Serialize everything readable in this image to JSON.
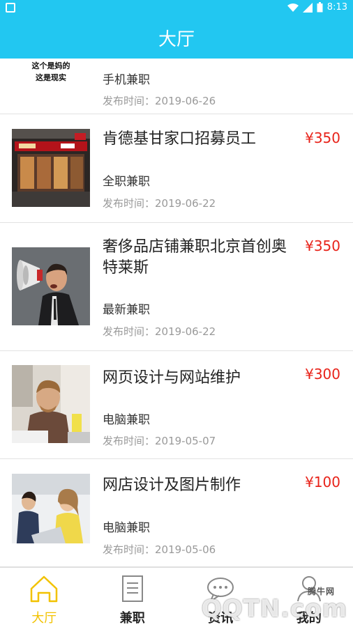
{
  "status_bar": {
    "time": "8:13"
  },
  "header": {
    "title": "大厅"
  },
  "jobs": [
    {
      "title": "",
      "thumb_text": [
        "这个是妈的",
        "这是现实"
      ],
      "category": "手机兼职",
      "date": "发布时间：2019-06-26",
      "price": ""
    },
    {
      "title": "肯德基甘家口招募员工",
      "category": "全职兼职",
      "date": "发布时间：2019-06-22",
      "price": "¥350"
    },
    {
      "title": "奢侈品店铺兼职北京首创奥特莱斯",
      "category": "最新兼职",
      "date": "发布时间：2019-06-22",
      "price": "¥350"
    },
    {
      "title": "网页设计与网站维护",
      "category": "电脑兼职",
      "date": "发布时间：2019-05-07",
      "price": "¥300"
    },
    {
      "title": "网店设计及图片制作",
      "category": "电脑兼职",
      "date": "发布时间：2019-05-06",
      "price": "¥100"
    }
  ],
  "tabs": [
    {
      "label": "大厅",
      "active": true
    },
    {
      "label": "兼职",
      "active": false
    },
    {
      "label": "资讯",
      "active": false
    },
    {
      "label": "我的",
      "active": false
    }
  ],
  "watermark": {
    "small": "腾牛网",
    "big": "QQTN.com"
  },
  "colors": {
    "primary": "#22c7f1",
    "price": "#e8231a",
    "active_tab": "#f2c200"
  }
}
